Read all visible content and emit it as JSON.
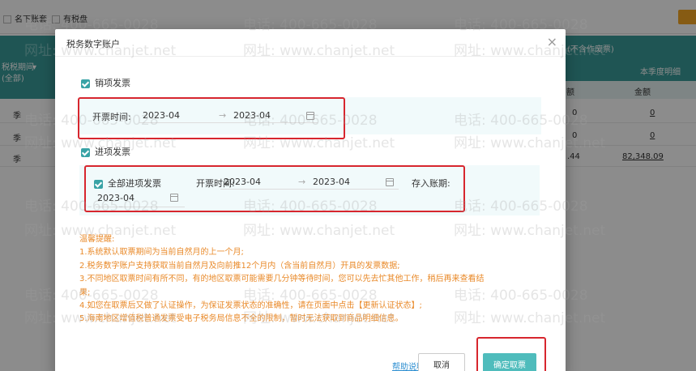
{
  "background": {
    "top_options": [
      "名下账套",
      "有税盘"
    ],
    "header_caption": "(不含作废票)",
    "header_left": "税税期间",
    "header_left_sub": "(全部)",
    "header_quarter": "本季度明细",
    "header_col_a": "额",
    "header_col_b": "金额",
    "rows": [
      {
        "period": "季",
        "col_a": "0",
        "col_b": "0"
      },
      {
        "period": "季",
        "col_a": "0",
        "col_b": "0"
      },
      {
        "period": "季",
        "col_a": ".44",
        "col_b": "82,348.09"
      }
    ]
  },
  "modal": {
    "title": "税务数字账户",
    "close": "×",
    "sales": {
      "label": "销项发票",
      "time_label": "开票时间:",
      "start": "2023-04",
      "arrow": "→",
      "end": "2023-04"
    },
    "purchase": {
      "label": "进项发票",
      "all_label": "全部进项发票",
      "time_label": "开票时间:",
      "start": "2023-04",
      "arrow": "→",
      "end": "2023-04",
      "period_label": "存入账期:",
      "period": "2023-04"
    },
    "tips": [
      "温馨提醒:",
      "1.系统默认取票期间为当前自然月的上一个月;",
      "2.税务数字账户支持获取当前自然月及向前推12个月内（含当前自然月）开具的发票数据;",
      "3.不同地区取票时间有所不同，有的地区取票可能需要几分钟等待时间，您可以先去忙其他工作，稍后再来查看结",
      "果;",
      "4.如您在取票后又做了认证操作，为保证发票状态的准确性，请在页面中点击【更新认证状态】;",
      "5.海南地区增值税普通发票受电子税务局信息不全的限制，暂时无法获取到商品明细信息。"
    ],
    "help": "帮助说明",
    "cancel": "取消",
    "confirm": "确定取票"
  },
  "watermark": {
    "phone": "电话: 400-665-0028",
    "site": "网址: www.chanjet.net"
  },
  "colors": {
    "teal": "#3a9b9a",
    "accent": "#4fbcbc",
    "highlight_box": "#d7262e",
    "tip_text": "#e98a2a"
  }
}
